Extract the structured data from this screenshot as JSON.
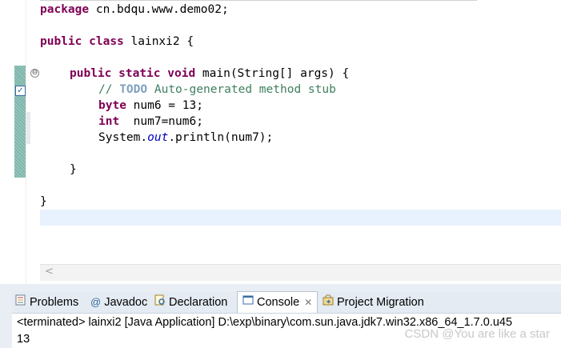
{
  "editor": {
    "lines": {
      "l1": {
        "kw": "package",
        "rest": " cn.bdqu.www.demo02;"
      },
      "l2": {
        "kw1": "public",
        "kw2": "class",
        "rest": " lainxi2 {"
      },
      "l3": {
        "kw1": "public",
        "kw2": "static",
        "kw3": "void",
        "rest": " main(String[] args) {"
      },
      "l4": {
        "prefix": "// ",
        "todo": "TODO",
        "rest": " Auto-generated method stub"
      },
      "l5": {
        "kw": "byte",
        "rest": " num6 = 13;"
      },
      "l6": {
        "kw": "int",
        "rest": "  num7=num6;"
      },
      "l7": {
        "pre": "System.",
        "field": "out",
        "post": ".println(num7);"
      },
      "l8": {
        "text": "}"
      },
      "l9": {
        "text": "}"
      }
    },
    "scroll_left": "<",
    "fold_glyph": "⊖",
    "check_glyph": "✓"
  },
  "panel": {
    "tabs": {
      "problems": {
        "label": "Problems",
        "icon": "problems-icon"
      },
      "javadoc": {
        "label": "Javadoc",
        "icon": "at-icon",
        "glyph": "@"
      },
      "declaration": {
        "label": "Declaration",
        "icon": "declaration-icon"
      },
      "console": {
        "label": "Console",
        "icon": "console-icon",
        "close": "✕"
      },
      "migration": {
        "label": "Project Migration",
        "icon": "migration-icon"
      }
    },
    "console": {
      "header": "<terminated> lainxi2 [Java Application] D:\\exp\\binary\\com.sun.java.jdk7.win32.x86_64_1.7.0.u45",
      "output": "13"
    }
  },
  "watermark": "CSDN @You are like a star"
}
